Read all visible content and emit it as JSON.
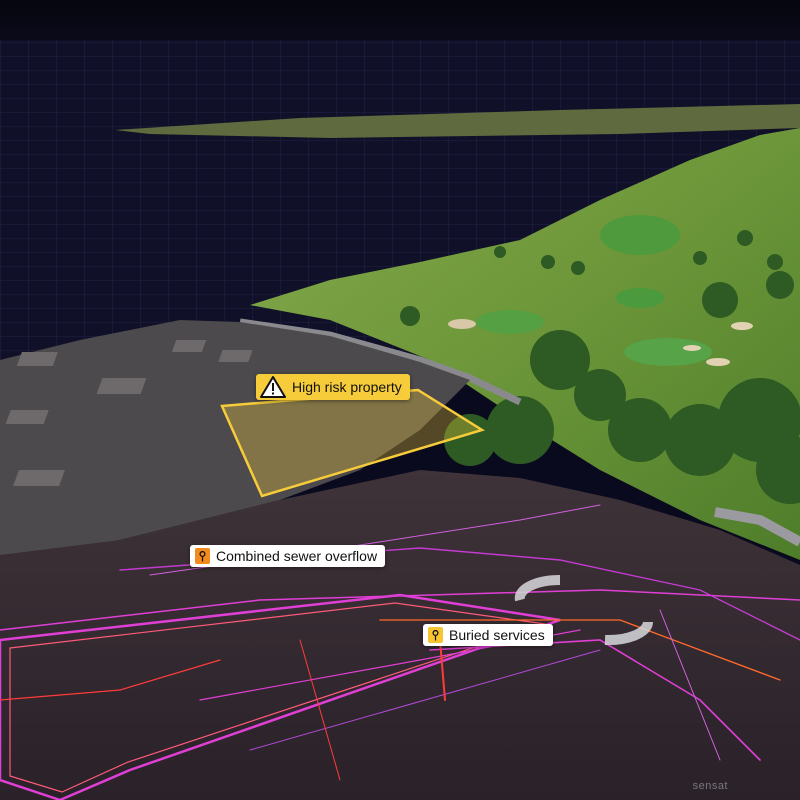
{
  "callouts": {
    "high_risk": {
      "label": "High risk property",
      "icon": "warning-triangle-icon",
      "color": "#f7cc3a"
    },
    "sewer": {
      "label": "Combined sewer overflow",
      "icon": "manhole-pin-icon",
      "color": "#f28a1e"
    },
    "buried": {
      "label": "Buried services",
      "icon": "manhole-pin-icon",
      "color": "#f7c531"
    }
  },
  "watermark": "sensat",
  "colors": {
    "sky": "#0a0a1e",
    "water_grid": "#14142e",
    "grass": "#6f9a3a",
    "field": "#3a3036",
    "utility_magenta": "#e03fd6",
    "utility_red": "#ff3b3b",
    "highlight": "#f7cc3a"
  }
}
